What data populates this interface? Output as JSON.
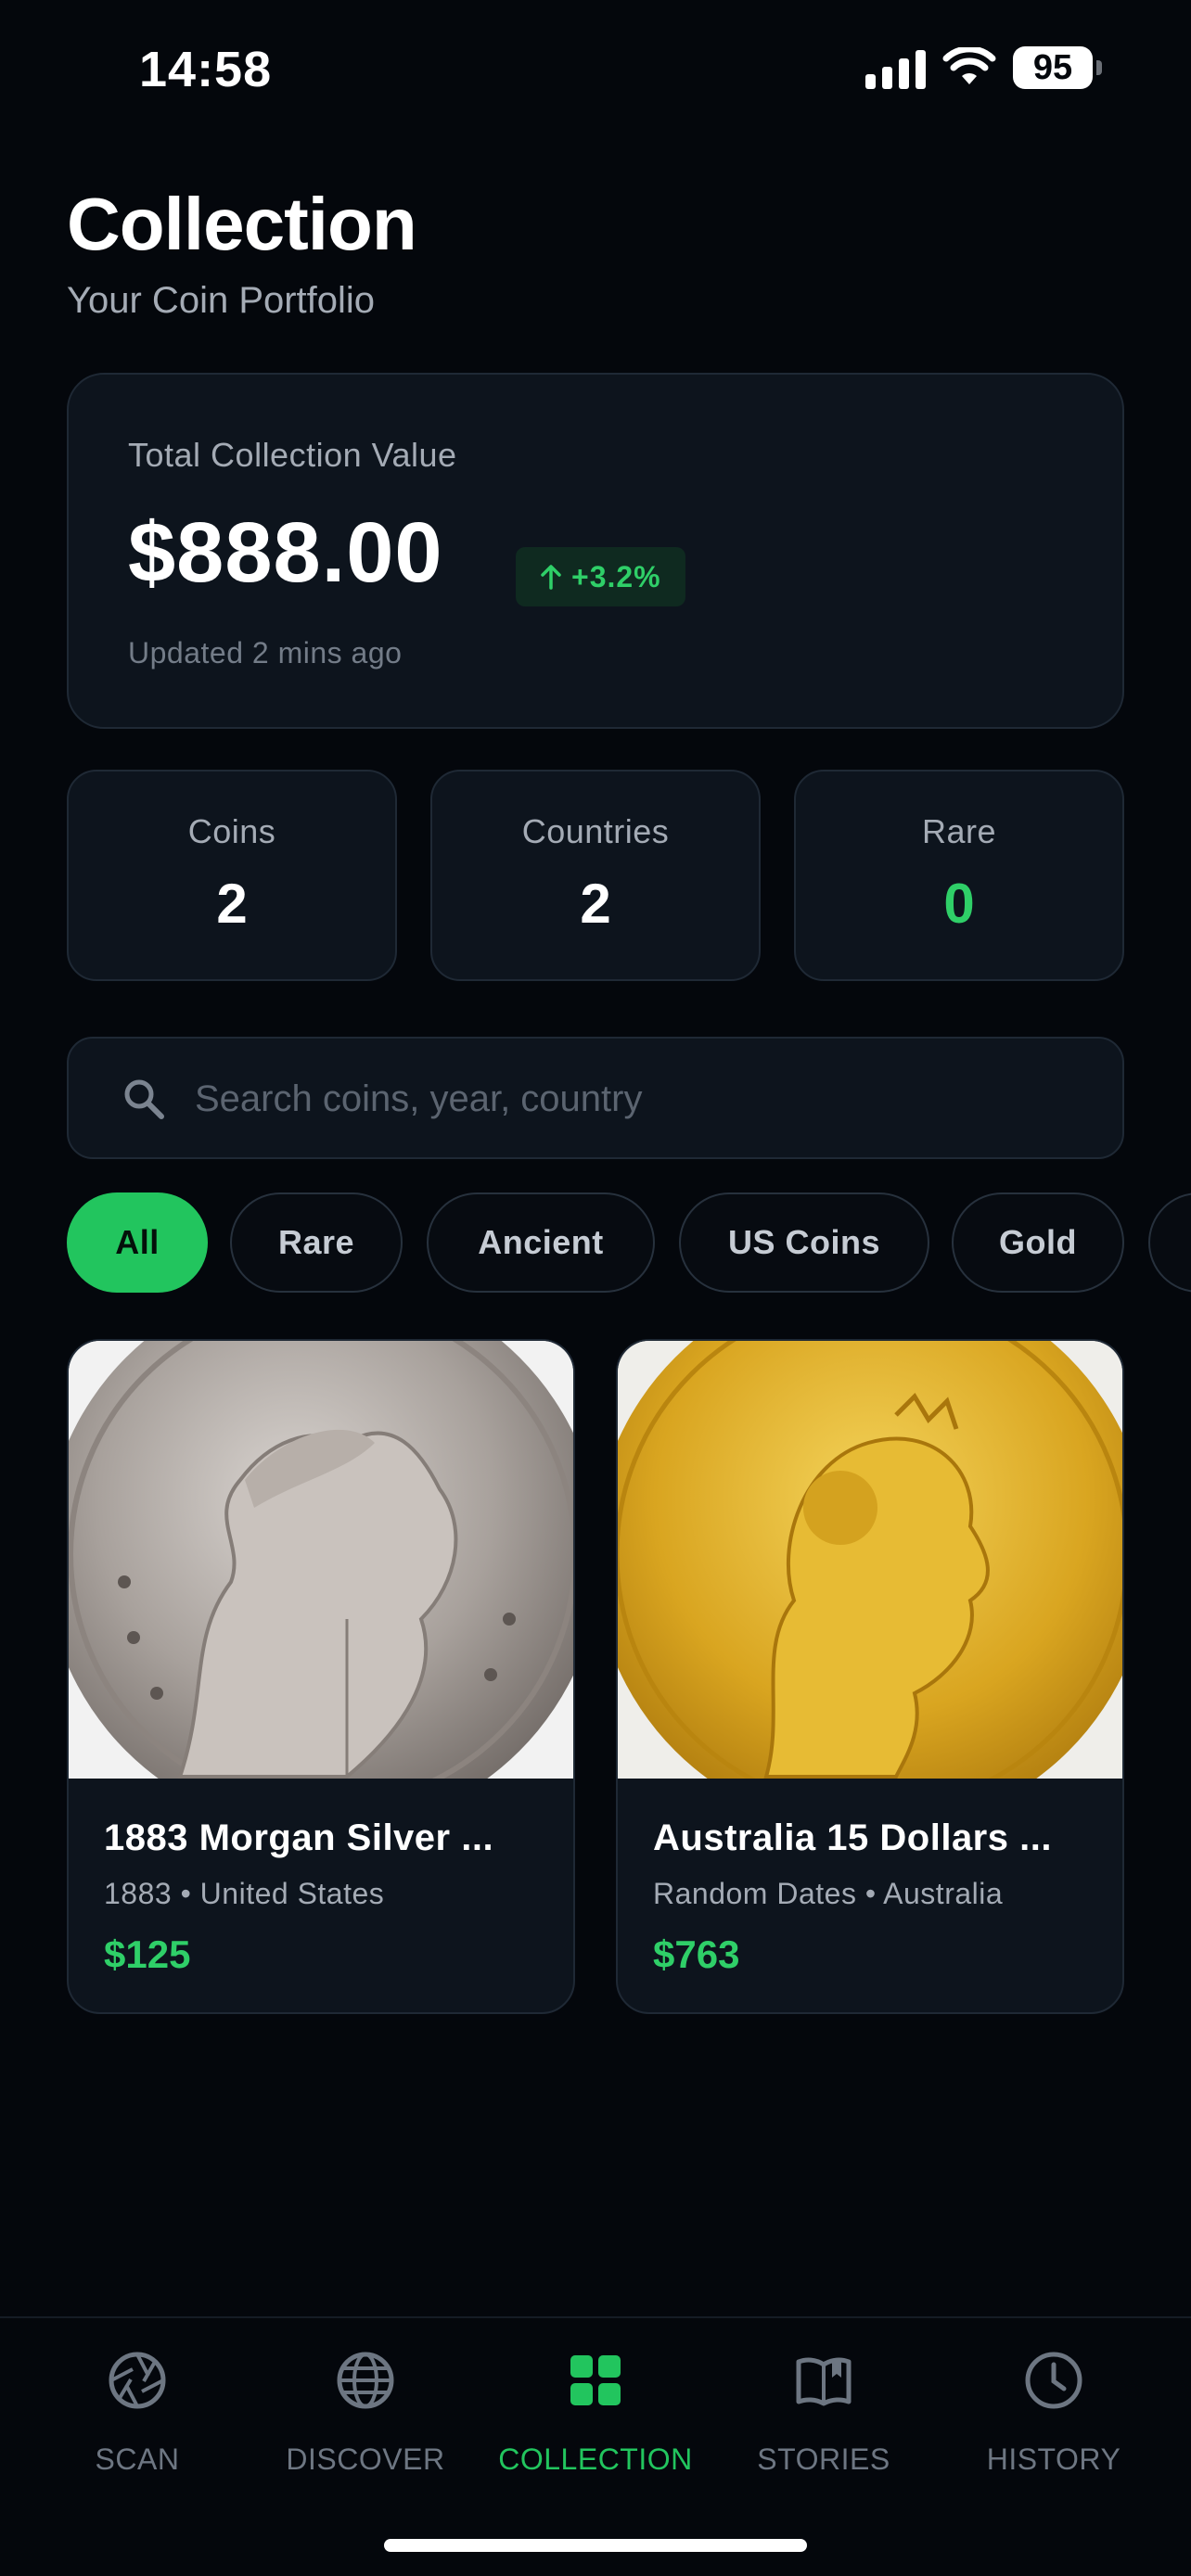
{
  "status_bar": {
    "time": "14:58",
    "battery": "95"
  },
  "header": {
    "title": "Collection",
    "subtitle": "Your Coin Portfolio"
  },
  "value_card": {
    "label": "Total Collection Value",
    "amount": "$888.00",
    "change": "+3.2%",
    "updated": "Updated 2 mins ago"
  },
  "stats": [
    {
      "label": "Coins",
      "value": "2"
    },
    {
      "label": "Countries",
      "value": "2"
    },
    {
      "label": "Rare",
      "value": "0"
    }
  ],
  "search": {
    "placeholder": "Search coins, year, country"
  },
  "filters": [
    "All",
    "Rare",
    "Ancient",
    "US Coins",
    "Gold"
  ],
  "active_filter": "All",
  "coins": [
    {
      "name": "1883 Morgan Silver ...",
      "meta": "1883 • United States",
      "price": "$125"
    },
    {
      "name": "Australia 15 Dollars ...",
      "meta": "Random Dates • Australia",
      "price": "$763"
    }
  ],
  "tabs": [
    {
      "label": "SCAN",
      "icon": "camera-aperture-icon"
    },
    {
      "label": "DISCOVER",
      "icon": "globe-icon"
    },
    {
      "label": "COLLECTION",
      "icon": "grid-icon"
    },
    {
      "label": "STORIES",
      "icon": "book-icon"
    },
    {
      "label": "HISTORY",
      "icon": "clock-icon"
    }
  ],
  "active_tab": "COLLECTION",
  "colors": {
    "accent": "#22c55e",
    "background": "#04070c",
    "card": "#0d141d"
  }
}
